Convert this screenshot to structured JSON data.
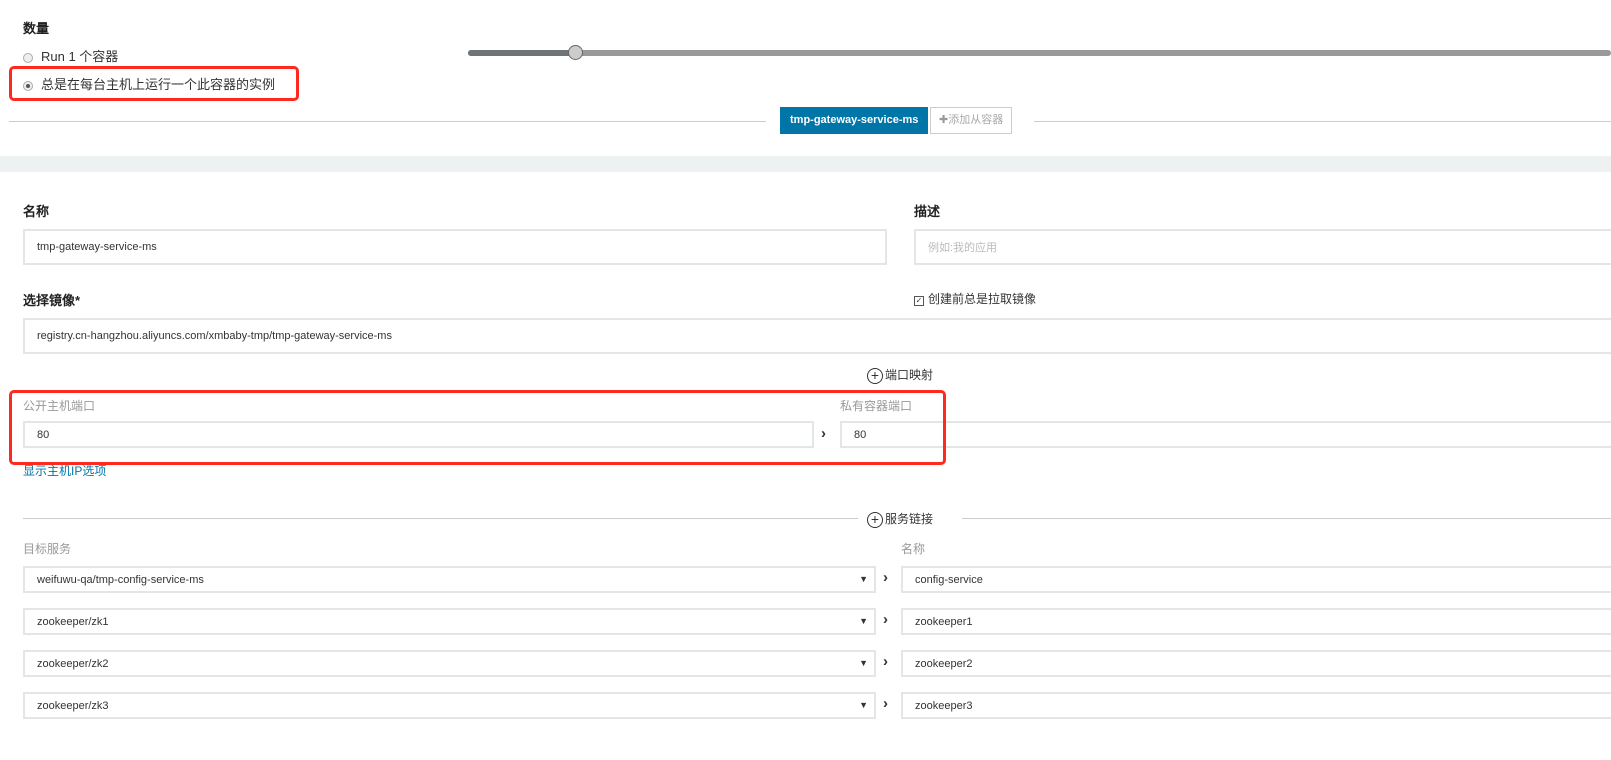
{
  "scale": {
    "title": "数量",
    "option_run": "Run 1 个容器",
    "option_always": "总是在每台主机上运行一个此容器的实例",
    "selected": "always",
    "slider_value": 1
  },
  "tabs": {
    "active": "tmp-gateway-service-ms",
    "add": "添加从容器"
  },
  "form": {
    "name_label": "名称",
    "name_value": "tmp-gateway-service-ms",
    "desc_label": "描述",
    "desc_placeholder": "例如:我的应用",
    "image_label": "选择镜像*",
    "image_value": "registry.cn-hangzhou.aliyuncs.com/xmbaby-tmp/tmp-gateway-service-ms",
    "pull_label": "创建前总是拉取镜像",
    "pull_checked": true
  },
  "ports": {
    "add_label": "端口映射",
    "public_label": "公开主机端口",
    "private_label": "私有容器端口",
    "public_value": "80",
    "private_value": "80",
    "show_ip_link": "显示主机IP选项"
  },
  "links": {
    "add_label": "服务链接",
    "target_label": "目标服务",
    "name_label": "名称",
    "rows": [
      {
        "service": "weifuwu-qa/tmp-config-service-ms",
        "alias": "config-service"
      },
      {
        "service": "zookeeper/zk1",
        "alias": "zookeeper1"
      },
      {
        "service": "zookeeper/zk2",
        "alias": "zookeeper2"
      },
      {
        "service": "zookeeper/zk3",
        "alias": "zookeeper3"
      }
    ]
  },
  "colors": {
    "accent": "#0075a8",
    "highlight": "#ff2a1f",
    "band": "#eef1f1"
  }
}
